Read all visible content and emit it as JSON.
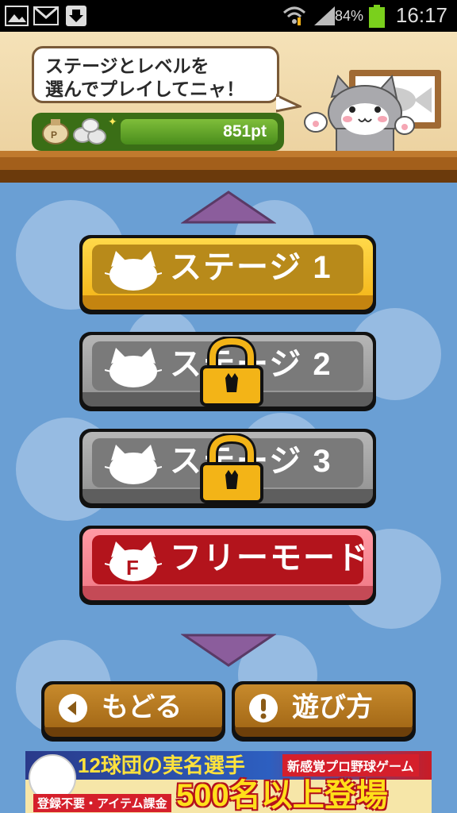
{
  "status_bar": {
    "battery_percent": "84%",
    "time": "16:17",
    "icons": [
      "image-icon",
      "gmail-icon",
      "download-icon",
      "wifi-icon",
      "signal-icon",
      "battery-icon"
    ]
  },
  "header": {
    "speech_line1": "ステージとレベルを",
    "speech_line2": "選んでプレイしてニャ！",
    "points_text": "851pt"
  },
  "stages": [
    {
      "label": "ステージ 1",
      "locked": false,
      "color": "#f3b417"
    },
    {
      "label": "ステージ 2",
      "locked": true,
      "color": "#8c8c8c"
    },
    {
      "label": "ステージ 3",
      "locked": true,
      "color": "#8c8c8c"
    }
  ],
  "free_mode": {
    "label": "フリーモード",
    "icon_letter": "F",
    "color": "#c0171f"
  },
  "nav": {
    "back_label": "もどる",
    "howto_label": "遊び方"
  },
  "ad": {
    "title": "12球団の実名選手",
    "subtitle": "新感覚プロ野球ゲーム",
    "note": "登録不要・アイテム課金",
    "headline": "500名以上登場"
  },
  "colors": {
    "background": "#6a9fd4",
    "header_wall": "#f2dcae",
    "button_gold": "#f3b417",
    "button_gray": "#8c8c8c",
    "button_red": "#c0171f",
    "nav_brown": "#b57820"
  }
}
